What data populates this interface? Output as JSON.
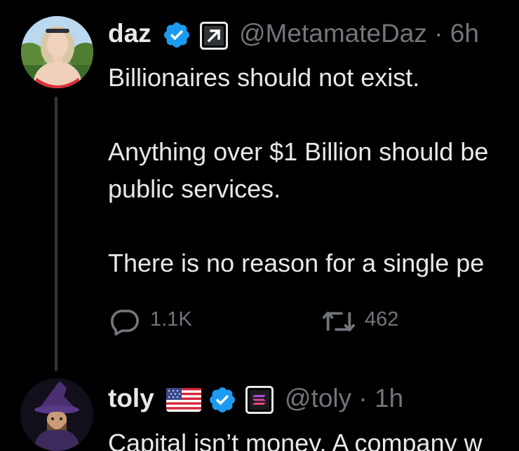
{
  "posts": [
    {
      "display_name": "daz",
      "handle": "@MetamateDaz",
      "separator": "·",
      "time": "6h",
      "body_lines": [
        "Billionaires should not exist.",
        "",
        "Anything over $1 Billion should be",
        "public services.",
        "",
        "There is no reason for a single pe"
      ],
      "reply_count": "1.1K",
      "repost_count": "462"
    },
    {
      "display_name": "toly",
      "handle": "@toly",
      "separator": "·",
      "time": "1h",
      "body_lines": [
        "Capital isn’t money.  A company w"
      ]
    }
  ],
  "icons": {
    "verified": "verified-badge-icon",
    "affiliate": "arrow-up-right-affiliate-icon",
    "flag": "us-flag-icon",
    "solana": "solana-logo-icon",
    "reply": "reply-bubble-icon",
    "repost": "repost-icon"
  },
  "colors": {
    "background": "#000000",
    "text_primary": "#e7e9ea",
    "text_secondary": "#71767b",
    "verified_blue": "#1d9bf0",
    "thread_line": "#333639"
  }
}
